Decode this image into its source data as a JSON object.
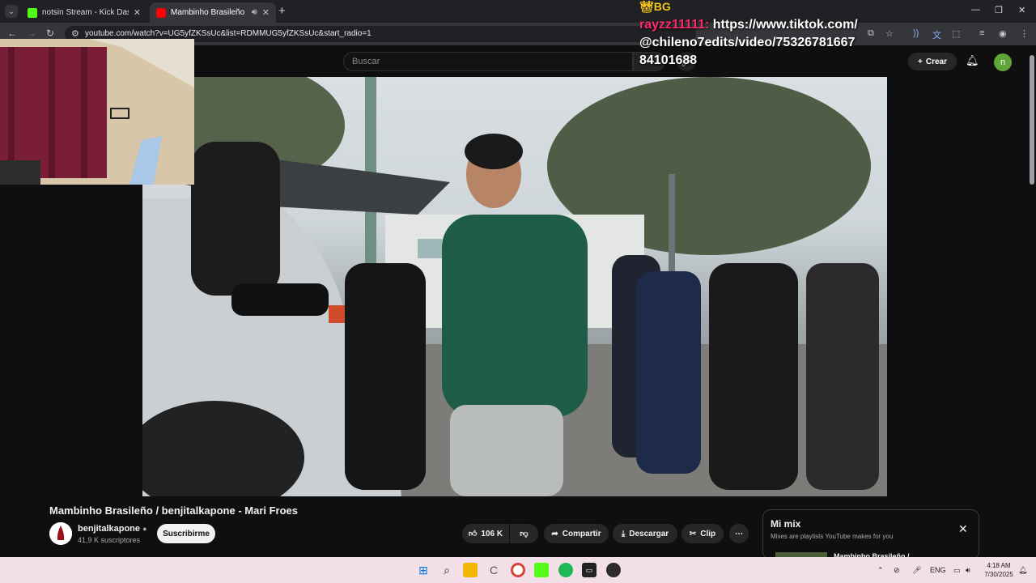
{
  "browser": {
    "tabs": [
      {
        "title": "notsin Stream - Kick Dashboard",
        "favicon_color": "#53fc18"
      },
      {
        "title": "Mambinho Brasileño / benj",
        "favicon_color": "#ff0000"
      }
    ],
    "url": "youtube.com/watch?v=UG5yfZKSsUc&list=RDMMUG5yfZKSsUc&start_radio=1"
  },
  "overlay": {
    "badge": "BG",
    "username": "rayzz11111:",
    "message": "https://www.tiktok.com/@chileno7edits/video/7532678166784101688"
  },
  "youtube": {
    "search_placeholder": "Buscar",
    "create_label": "Crear",
    "avatar_letter": "n",
    "video": {
      "title": "Mambinho Brasileño / benjitalkapone - Mari Froes",
      "channel": "benjitalkapone",
      "subscribers": "41,9 K suscriptores",
      "subscribe_label": "Suscribirme",
      "likes": "106 K",
      "share_label": "Compartir",
      "download_label": "Descargar",
      "clip_label": "Clip"
    },
    "mix": {
      "title": "Mi mix",
      "subtitle": "Mixes are playlists YouTube makes for you",
      "first_item": "Mambinho Brasileño /"
    }
  },
  "taskbar": {
    "language": "ENG",
    "time": "4:18 AM",
    "date": "7/30/2025"
  },
  "colors": {
    "yt_bg": "#0f0f0f",
    "taskbar_bg": "#f2dfe8",
    "avatar_green": "#5fa53a"
  }
}
